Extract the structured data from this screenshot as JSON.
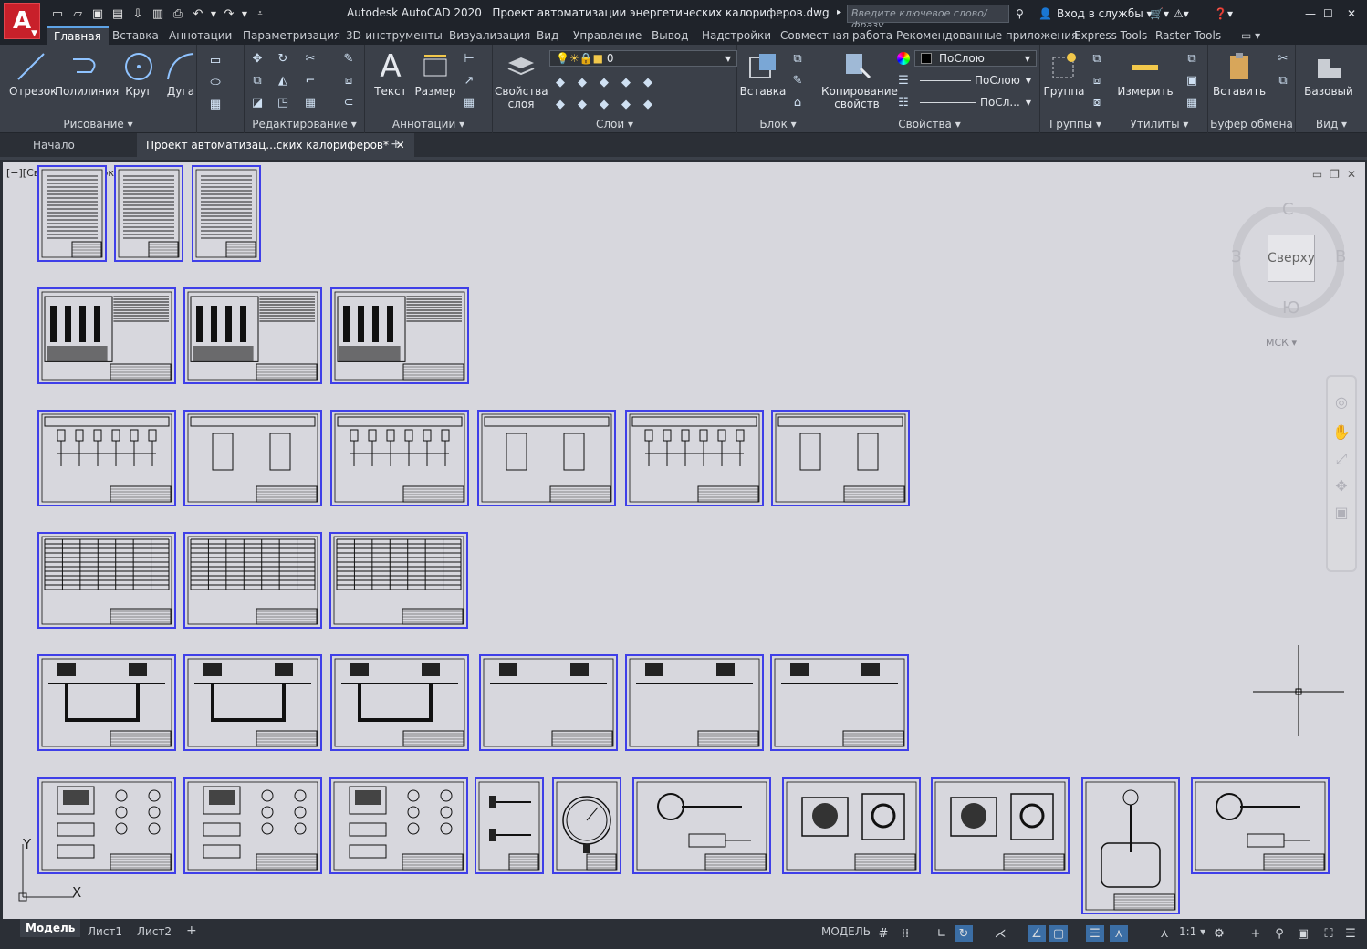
{
  "app": {
    "title": "Autodesk AutoCAD 2020",
    "file": "Проект автоматизации энергетических калориферов.dwg",
    "logo_letter": "A"
  },
  "search": {
    "placeholder": "Введите ключевое слово/фразу"
  },
  "titlebar": {
    "signin": "Вход в службы"
  },
  "menu": [
    "Главная",
    "Вставка",
    "Аннотации",
    "Параметризация",
    "3D-инструменты",
    "Визуализация",
    "Вид",
    "Управление",
    "Вывод",
    "Надстройки",
    "Совместная работа",
    "Рекомендованные приложения",
    "Express Tools",
    "Raster Tools"
  ],
  "ribbon": {
    "draw": {
      "title": "Рисование",
      "line": "Отрезок",
      "polyline": "Полилиния",
      "circle": "Круг",
      "arc": "Дуга"
    },
    "modify": {
      "title": "Редактирование"
    },
    "annotation": {
      "title": "Аннотации",
      "text": "Текст",
      "dimension": "Размер"
    },
    "layers": {
      "title": "Слои",
      "layer_props_1": "Свойства",
      "layer_props_2": "слоя",
      "current_layer": "0"
    },
    "block": {
      "title": "Блок",
      "insert": "Вставка"
    },
    "properties": {
      "title": "Свойства",
      "match_1": "Копирование",
      "match_2": "свойств",
      "color": "ПоСлою",
      "linetype": "ПоСлою",
      "lineweight": "ПоСл..."
    },
    "groups": {
      "title": "Группы",
      "group": "Группа"
    },
    "utilities": {
      "title": "Утилиты",
      "measure": "Измерить"
    },
    "clipboard": {
      "title": "Буфер обмена",
      "paste": "Вставить"
    },
    "view": {
      "title": "Вид",
      "base": "Базовый"
    }
  },
  "doctabs": {
    "start": "Начало",
    "current": "Проект автоматизац...ских калориферов*"
  },
  "viewport": {
    "label": "[−][Сверху][2D-каркас]"
  },
  "viewcube": {
    "top": "Сверху",
    "n": "С",
    "s": "Ю",
    "w": "З",
    "e": "В",
    "ucs": "МСК"
  },
  "ucs": {
    "x": "X",
    "y": "Y"
  },
  "status": {
    "tabs": [
      "Модель",
      "Лист1",
      "Лист2"
    ],
    "model": "МОДЕЛЬ",
    "scale": "1:1"
  }
}
